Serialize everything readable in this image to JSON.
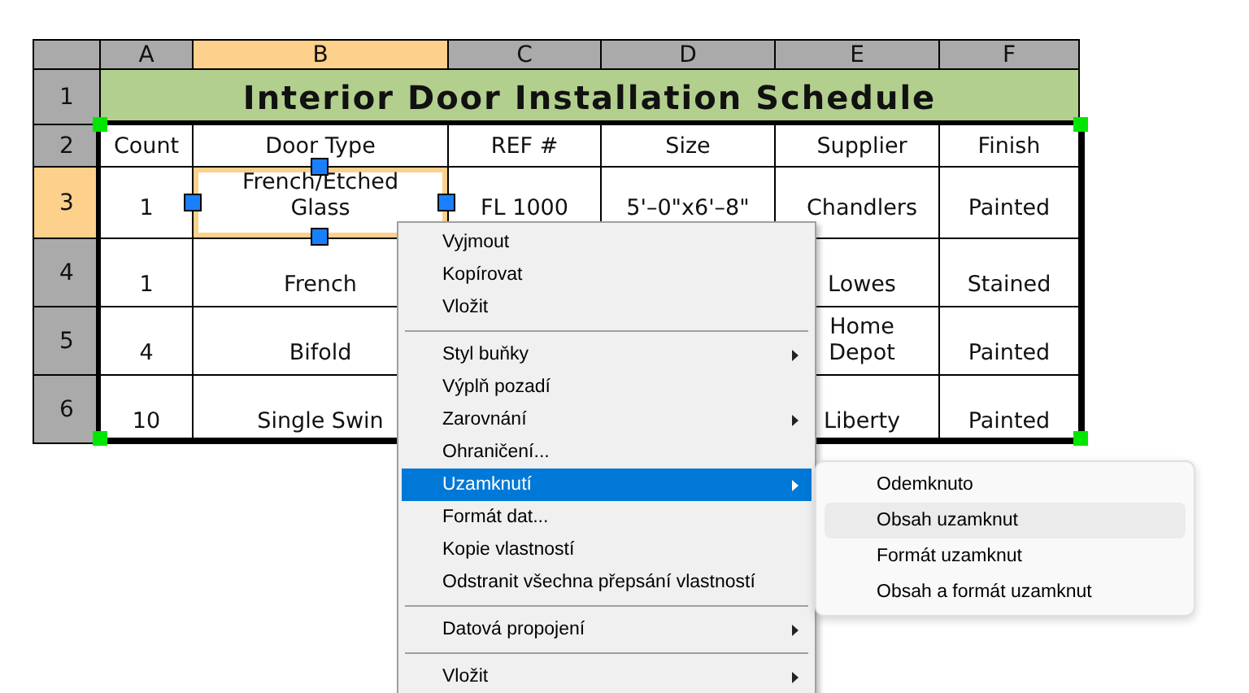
{
  "sheet": {
    "columns": [
      {
        "label": "A",
        "selected": false
      },
      {
        "label": "B",
        "selected": true
      },
      {
        "label": "C",
        "selected": false
      },
      {
        "label": "D",
        "selected": false
      },
      {
        "label": "E",
        "selected": false
      },
      {
        "label": "F",
        "selected": false
      }
    ],
    "title_row": {
      "header": "1",
      "title": "Interior Door Installation Schedule"
    },
    "rows": [
      {
        "header": "2",
        "selected": false,
        "cells": [
          "Count",
          "Door Type",
          "REF #",
          "Size",
          "Supplier",
          "Finish"
        ]
      },
      {
        "header": "3",
        "selected": true,
        "cells": [
          "1",
          "French/Etched Glass",
          "FL 1000",
          "5'–0\"x6'–8\"",
          "Chandlers",
          "Painted"
        ]
      },
      {
        "header": "4",
        "selected": false,
        "cells": [
          "1",
          "French",
          null,
          null,
          "Lowes",
          "Stained"
        ]
      },
      {
        "header": "5",
        "selected": false,
        "cells": [
          "4",
          "Bifold",
          null,
          null,
          "Home Depot",
          "Painted"
        ]
      },
      {
        "header": "6",
        "selected": false,
        "cells": [
          "10",
          "Single Swin",
          null,
          null,
          "Liberty",
          "Painted"
        ]
      }
    ]
  },
  "context_menu": {
    "items": [
      {
        "kind": "item",
        "label": "Vyjmout",
        "submenu": false,
        "selected": false
      },
      {
        "kind": "item",
        "label": "Kopírovat",
        "submenu": false,
        "selected": false
      },
      {
        "kind": "item",
        "label": "Vložit",
        "submenu": false,
        "selected": false
      },
      {
        "kind": "separator"
      },
      {
        "kind": "item",
        "label": "Styl buňky",
        "submenu": true,
        "selected": false
      },
      {
        "kind": "item",
        "label": "Výplň pozadí",
        "submenu": false,
        "selected": false
      },
      {
        "kind": "item",
        "label": "Zarovnání",
        "submenu": true,
        "selected": false
      },
      {
        "kind": "item",
        "label": "Ohraničení...",
        "submenu": false,
        "selected": false
      },
      {
        "kind": "item",
        "label": "Uzamknutí",
        "submenu": true,
        "selected": true
      },
      {
        "kind": "item",
        "label": "Formát dat...",
        "submenu": false,
        "selected": false
      },
      {
        "kind": "item",
        "label": "Kopie vlastností",
        "submenu": false,
        "selected": false
      },
      {
        "kind": "item",
        "label": "Odstranit všechna přepsání vlastností",
        "submenu": false,
        "selected": false
      },
      {
        "kind": "separator"
      },
      {
        "kind": "item",
        "label": "Datová propojení",
        "submenu": true,
        "selected": false
      },
      {
        "kind": "separator"
      },
      {
        "kind": "item",
        "label": "Vložit",
        "submenu": true,
        "selected": false
      }
    ]
  },
  "submenu": {
    "items": [
      {
        "label": "Odemknuto",
        "selected": false
      },
      {
        "label": "Obsah uzamknut",
        "selected": true
      },
      {
        "label": "Formát uzamknut",
        "selected": false
      },
      {
        "label": "Obsah a formát uzamknut",
        "selected": false
      }
    ]
  }
}
